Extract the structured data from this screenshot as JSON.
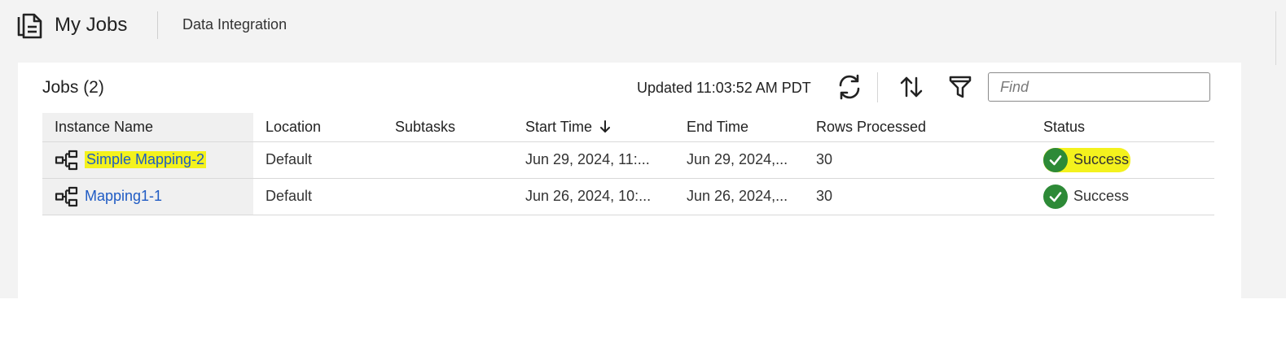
{
  "header": {
    "title": "My Jobs",
    "breadcrumb": "Data Integration"
  },
  "jobs_panel": {
    "title": "Jobs (2)",
    "updated_text": "Updated 11:03:52 AM PDT",
    "find_placeholder": "Find"
  },
  "table": {
    "columns": [
      "Instance Name",
      "Location",
      "Subtasks",
      "Start Time",
      "End Time",
      "Rows Processed",
      "Status"
    ],
    "sorted_column": "Start Time",
    "sort_direction": "descending",
    "rows": [
      {
        "instance_name": "Simple Mapping-2",
        "location": "Default",
        "subtasks": "",
        "start_time": "Jun 29, 2024, 11:...",
        "end_time": "Jun 29, 2024,...",
        "rows_processed": "30",
        "status": "Success",
        "highlighted": true
      },
      {
        "instance_name": "Mapping1-1",
        "location": "Default",
        "subtasks": "",
        "start_time": "Jun 26, 2024, 10:...",
        "end_time": "Jun 26, 2024,...",
        "rows_processed": "30",
        "status": "Success",
        "highlighted": false
      }
    ]
  },
  "icons": {
    "header": "jobs-document-icon",
    "refresh": "refresh-icon",
    "sort": "sort-icon",
    "filter": "filter-icon",
    "row_type": "mapping-icon",
    "status": "success-check-icon"
  },
  "colors": {
    "link": "#1f5bc4",
    "success": "#2d8a37",
    "highlight": "#f4f21d"
  }
}
